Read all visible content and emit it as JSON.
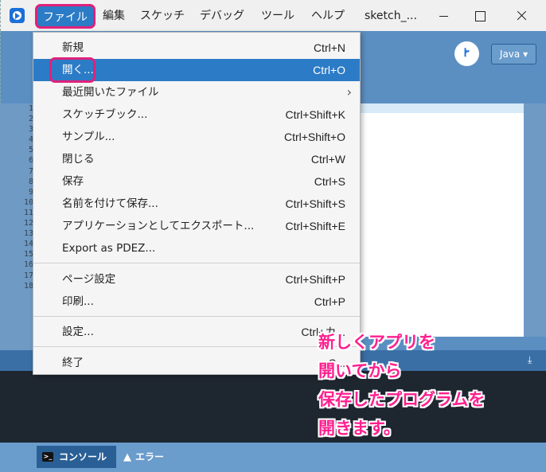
{
  "menubar": {
    "file": "ファイル",
    "edit": "編集",
    "sketch": "スケッチ",
    "debug": "デバッグ",
    "tools": "ツール",
    "help": "ヘルプ",
    "sketch_name": "sketch_..."
  },
  "toolbar": {
    "mode_icon_text": "Ꭸ",
    "java_mode": "Java ▾"
  },
  "gutter": {
    "lines": [
      "1",
      "2",
      "3",
      "4",
      "5",
      "6",
      "7",
      "8",
      "9",
      "10",
      "11",
      "12",
      "13",
      "14",
      "15",
      "16",
      "17",
      "18"
    ]
  },
  "file_menu": {
    "items": [
      {
        "label": "新規",
        "shortcut": "Ctrl+N"
      },
      {
        "label": "開く...",
        "shortcut": "Ctrl+O"
      },
      {
        "label": "最近開いたファイル",
        "shortcut": ""
      },
      {
        "label": "スケッチブック...",
        "shortcut": "Ctrl+Shift+K"
      },
      {
        "label": "サンプル...",
        "shortcut": "Ctrl+Shift+O"
      },
      {
        "label": "閉じる",
        "shortcut": "Ctrl+W"
      },
      {
        "label": "保存",
        "shortcut": "Ctrl+S"
      },
      {
        "label": "名前を付けて保存...",
        "shortcut": "Ctrl+Shift+S"
      },
      {
        "label": "アプリケーションとしてエクスポート...",
        "shortcut": "Ctrl+Shift+E"
      },
      {
        "label": "Export as PDEZ...",
        "shortcut": ""
      },
      {
        "label": "ページ設定",
        "shortcut": "Ctrl+Shift+P"
      },
      {
        "label": "印刷...",
        "shortcut": "Ctrl+P"
      },
      {
        "label": "設定...",
        "shortcut": "Ctrl+カ..."
      },
      {
        "label": "終了",
        "shortcut": "C..."
      }
    ]
  },
  "console": {
    "tab_console": "コンソール",
    "tab_error": "エラー"
  },
  "annotation": {
    "line1": "新しくアプリを",
    "line2": "開いてから",
    "line3": "保存したプログラムを",
    "line4": "開きます。"
  },
  "colors": {
    "accent": "#2c7bc6",
    "highlight_border": "#e0217a",
    "annotation_text": "#ff1f8e"
  }
}
